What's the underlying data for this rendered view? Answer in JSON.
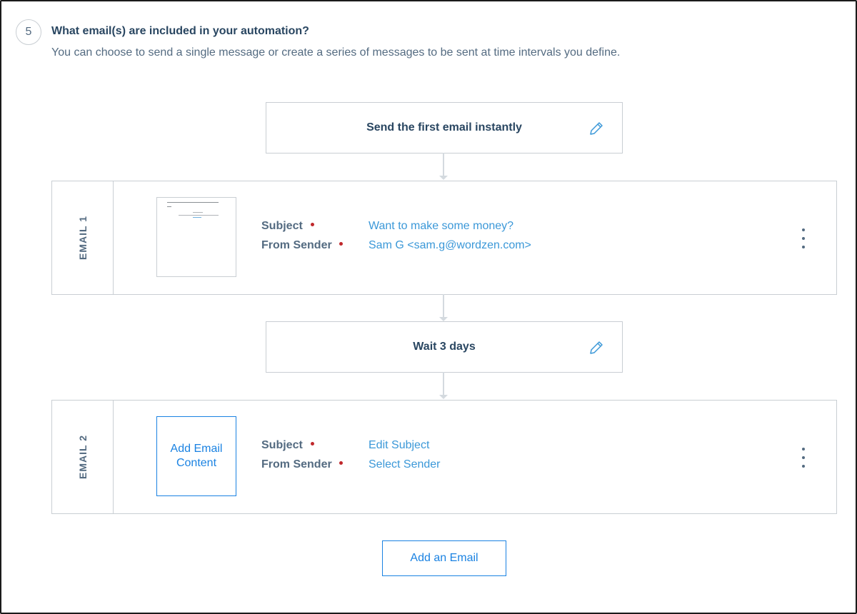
{
  "step": {
    "number": "5",
    "title": "What email(s) are included in your automation?",
    "subtitle": "You can choose to send a single message or create a series of messages to be sent at time intervals you define."
  },
  "timing_boxes": [
    {
      "label": "Send the first email instantly",
      "icon": "pencil-icon"
    },
    {
      "label": "Wait 3 days",
      "icon": "pencil-icon"
    }
  ],
  "emails": [
    {
      "tag": "EMAIL 1",
      "has_content": true,
      "subject_label": "Subject",
      "subject_value": "Want to make some money?",
      "sender_label": "From Sender",
      "sender_value": "Sam G <sam.g@wordzen.com>",
      "menu_icon": "kebab-menu-icon"
    },
    {
      "tag": "EMAIL 2",
      "has_content": false,
      "add_content_label": "Add Email Content",
      "subject_label": "Subject",
      "subject_value": "Edit Subject",
      "sender_label": "From Sender",
      "sender_value": "Select Sender",
      "menu_icon": "kebab-menu-icon"
    }
  ],
  "add_email_button": "Add an Email",
  "colors": {
    "heading": "#294661",
    "text": "#546b81",
    "link": "#3b98d8",
    "accent": "#1a82e2",
    "required": "#c0282c",
    "border": "#c9ced3"
  }
}
